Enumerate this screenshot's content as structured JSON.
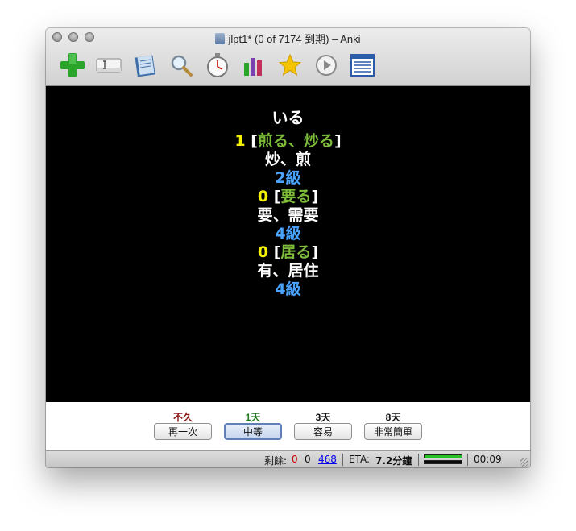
{
  "window": {
    "title": "jlpt1* (0 of 7174 到期) – Anki"
  },
  "toolbar": {
    "items": [
      {
        "icon": "add-cross-icon",
        "color": "#2aa52a"
      },
      {
        "icon": "edit-field-icon"
      },
      {
        "icon": "notebook-icon"
      },
      {
        "icon": "magnifier-icon"
      },
      {
        "icon": "stopwatch-icon"
      },
      {
        "icon": "stats-bars-icon"
      },
      {
        "icon": "star-icon",
        "color": "#f5c400"
      },
      {
        "icon": "play-icon"
      },
      {
        "icon": "list-icon"
      }
    ]
  },
  "card": {
    "word": "いる",
    "entries": [
      {
        "num": "1",
        "bracket_open": "[",
        "reading": "煎る、炒る",
        "bracket_close": "]",
        "meaning": "炒、煎",
        "level": "2級"
      },
      {
        "num": "0",
        "bracket_open": "[",
        "reading": "要る",
        "bracket_close": "]",
        "meaning": "要、需要",
        "level": "4級"
      },
      {
        "num": "0",
        "bracket_open": "[",
        "reading": "居る",
        "bracket_close": "]",
        "meaning": "有、居住",
        "level": "4級"
      }
    ]
  },
  "answers": [
    {
      "interval": "不久",
      "interval_color": "#8b1a1a",
      "label": "再一次",
      "default": false
    },
    {
      "interval": "1天",
      "interval_color": "#1f7a1f",
      "label": "中等",
      "default": true
    },
    {
      "interval": "3天",
      "interval_color": "#111111",
      "label": "容易",
      "default": false
    },
    {
      "interval": "8天",
      "interval_color": "#111111",
      "label": "非常簡單",
      "default": false
    }
  ],
  "status": {
    "remaining_label": "剩餘:",
    "new_count": "0",
    "learn_count": "0",
    "review_count": "468",
    "eta_label": "ETA:",
    "eta_value": "7.2分鐘",
    "progress": [
      1.0,
      0.0
    ],
    "timer": "00:09"
  },
  "colors": {
    "card_bg": "#000000",
    "num": "#f3f300",
    "reading": "#7dbb3a",
    "level": "#4aa3ff",
    "new_count": "#cc0000",
    "review_count": "#0000ee"
  }
}
